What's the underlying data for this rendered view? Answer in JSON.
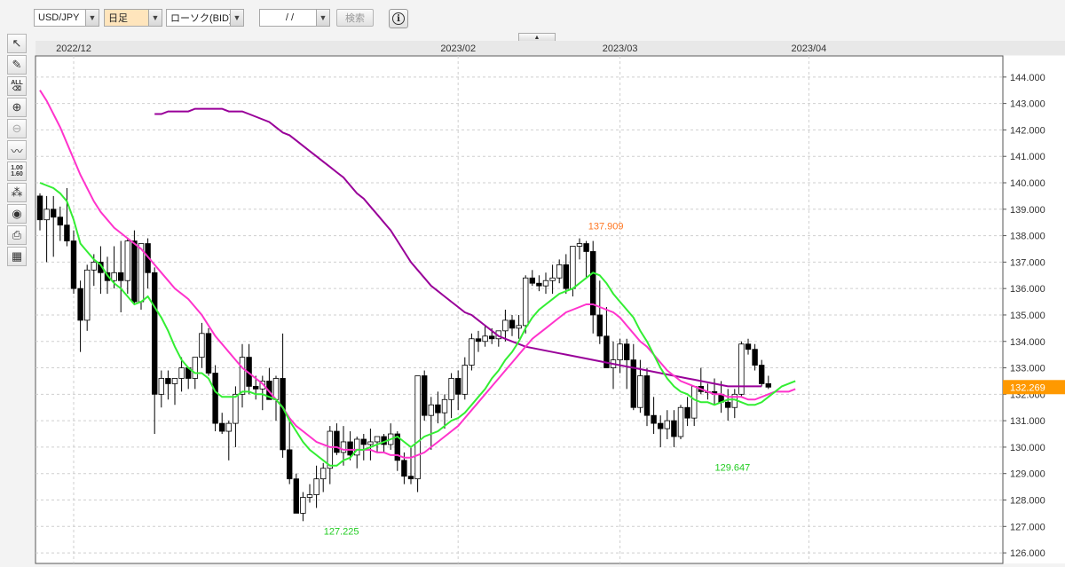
{
  "toolbar": {
    "symbol": "USD/JPY",
    "timeframe": "日足",
    "chart_style": "ローソク(BID)",
    "date_value": "/ /",
    "search_label": "検索"
  },
  "colors": {
    "up": "#ffffff",
    "down": "#000000",
    "ma_short": "#33ee33",
    "ma_mid": "#ff33cc",
    "ma_long": "#990099",
    "high_label": "#ff7722",
    "low_label": "#22cc22",
    "price_tag": "#ff9900"
  },
  "chart_data": {
    "type": "candlestick",
    "x_ticks": [
      {
        "index": 5,
        "label": "2022/12"
      },
      {
        "index": 62,
        "label": "2023/02"
      },
      {
        "index": 86,
        "label": "2023/03"
      },
      {
        "index": 114,
        "label": "2023/04"
      }
    ],
    "ylim": [
      125.6,
      144.8
    ],
    "y_ticks": [
      126,
      127,
      128,
      129,
      130,
      131,
      132,
      133,
      134,
      135,
      136,
      137,
      138,
      139,
      140,
      141,
      142,
      143,
      144
    ],
    "current_price": "132.269",
    "annotations": [
      {
        "index": 86,
        "value": 137.909,
        "label": "137.909",
        "kind": "high"
      },
      {
        "index": 46,
        "value": 127.225,
        "label": "127.225",
        "kind": "low"
      },
      {
        "index": 104,
        "value": 129.647,
        "label": "129.647",
        "kind": "low"
      }
    ],
    "candles": [
      [
        139.5,
        139.6,
        138.2,
        138.6
      ],
      [
        138.6,
        139.5,
        137.0,
        139.0
      ],
      [
        139.0,
        139.5,
        137.2,
        138.7
      ],
      [
        138.7,
        139.1,
        137.8,
        138.4
      ],
      [
        138.4,
        139.8,
        137.6,
        137.8
      ],
      [
        137.8,
        138.2,
        135.8,
        136.0
      ],
      [
        136.0,
        136.3,
        133.6,
        134.8
      ],
      [
        134.8,
        136.9,
        134.4,
        136.7
      ],
      [
        136.7,
        137.3,
        136.1,
        137.0
      ],
      [
        137.0,
        137.6,
        135.8,
        136.6
      ],
      [
        136.6,
        137.2,
        135.8,
        136.3
      ],
      [
        136.3,
        137.6,
        136.0,
        136.6
      ],
      [
        136.6,
        137.8,
        135.1,
        136.3
      ],
      [
        136.3,
        137.9,
        135.8,
        137.8
      ],
      [
        137.8,
        138.2,
        135.4,
        135.5
      ],
      [
        135.5,
        137.6,
        135.2,
        137.7
      ],
      [
        137.7,
        137.9,
        136.0,
        136.6
      ],
      [
        136.6,
        136.8,
        130.5,
        132.0
      ],
      [
        132.0,
        132.9,
        131.5,
        132.6
      ],
      [
        132.6,
        132.9,
        131.8,
        132.4
      ],
      [
        132.4,
        132.6,
        131.6,
        132.6
      ],
      [
        132.6,
        133.4,
        132.1,
        133.0
      ],
      [
        133.0,
        133.0,
        132.2,
        132.6
      ],
      [
        132.6,
        133.3,
        132.2,
        133.4
      ],
      [
        133.4,
        134.7,
        133.0,
        134.3
      ],
      [
        134.3,
        134.5,
        132.7,
        132.8
      ],
      [
        132.8,
        133.1,
        130.6,
        130.9
      ],
      [
        130.9,
        131.3,
        130.5,
        130.6
      ],
      [
        130.6,
        131.0,
        129.5,
        130.9
      ],
      [
        130.9,
        132.3,
        130.0,
        132.0
      ],
      [
        132.0,
        133.9,
        131.5,
        133.4
      ],
      [
        133.4,
        133.9,
        132.0,
        132.3
      ],
      [
        132.3,
        132.7,
        131.8,
        132.2
      ],
      [
        132.2,
        132.7,
        131.4,
        132.5
      ],
      [
        132.5,
        133.0,
        131.9,
        131.8
      ],
      [
        131.8,
        132.7,
        131.0,
        132.6
      ],
      [
        132.6,
        134.3,
        129.6,
        129.9
      ],
      [
        129.9,
        131.0,
        128.6,
        128.8
      ],
      [
        128.8,
        129.0,
        127.5,
        127.5
      ],
      [
        127.5,
        128.3,
        127.2,
        128.1
      ],
      [
        128.1,
        128.6,
        127.9,
        128.2
      ],
      [
        128.2,
        129.3,
        127.7,
        128.8
      ],
      [
        128.8,
        129.4,
        128.3,
        129.2
      ],
      [
        129.2,
        130.8,
        128.6,
        130.6
      ],
      [
        130.6,
        130.9,
        129.7,
        129.8
      ],
      [
        129.8,
        130.8,
        129.3,
        130.2
      ],
      [
        130.2,
        130.6,
        129.5,
        129.7
      ],
      [
        129.7,
        130.4,
        129.2,
        130.3
      ],
      [
        130.3,
        130.5,
        129.5,
        130.1
      ],
      [
        130.1,
        130.7,
        129.5,
        130.2
      ],
      [
        130.2,
        130.4,
        129.8,
        130.4
      ],
      [
        130.4,
        130.5,
        129.8,
        130.1
      ],
      [
        130.1,
        130.9,
        129.9,
        130.5
      ],
      [
        130.5,
        130.6,
        129.1,
        129.5
      ],
      [
        129.5,
        129.8,
        128.6,
        128.9
      ],
      [
        128.9,
        130.0,
        128.6,
        128.8
      ],
      [
        128.8,
        132.0,
        128.3,
        132.7
      ],
      [
        132.7,
        132.9,
        131.0,
        131.2
      ],
      [
        131.2,
        131.9,
        129.9,
        131.6
      ],
      [
        131.6,
        132.1,
        130.9,
        131.3
      ],
      [
        131.3,
        132.0,
        130.7,
        131.8
      ],
      [
        131.8,
        132.8,
        131.1,
        132.6
      ],
      [
        132.6,
        132.9,
        131.4,
        132.0
      ],
      [
        132.0,
        133.4,
        131.8,
        133.1
      ],
      [
        133.1,
        134.3,
        132.9,
        134.1
      ],
      [
        134.1,
        134.4,
        133.6,
        134.0
      ],
      [
        134.0,
        134.6,
        133.8,
        134.2
      ],
      [
        134.2,
        134.5,
        133.9,
        134.1
      ],
      [
        134.1,
        134.3,
        133.8,
        134.4
      ],
      [
        134.4,
        135.2,
        134.0,
        134.8
      ],
      [
        134.8,
        135.0,
        134.2,
        134.5
      ],
      [
        134.5,
        135.0,
        134.1,
        134.6
      ],
      [
        134.6,
        136.5,
        134.3,
        136.4
      ],
      [
        136.4,
        136.7,
        136.1,
        136.2
      ],
      [
        136.2,
        136.5,
        135.9,
        136.1
      ],
      [
        136.1,
        136.6,
        135.8,
        136.3
      ],
      [
        136.3,
        136.9,
        135.8,
        136.4
      ],
      [
        136.4,
        137.1,
        136.2,
        136.9
      ],
      [
        136.9,
        137.3,
        135.8,
        136.0
      ],
      [
        136.0,
        137.6,
        135.7,
        137.6
      ],
      [
        137.6,
        137.9,
        137.1,
        137.7
      ],
      [
        137.7,
        137.8,
        136.4,
        137.4
      ],
      [
        137.4,
        137.8,
        134.3,
        135.0
      ],
      [
        135.0,
        136.3,
        133.9,
        134.2
      ],
      [
        134.2,
        135.3,
        133.1,
        133.0
      ],
      [
        133.0,
        134.0,
        132.2,
        133.3
      ],
      [
        133.3,
        134.1,
        132.8,
        133.9
      ],
      [
        133.9,
        134.1,
        132.2,
        133.3
      ],
      [
        133.3,
        133.9,
        131.4,
        131.5
      ],
      [
        131.5,
        133.3,
        131.3,
        132.7
      ],
      [
        132.7,
        133.0,
        130.8,
        131.2
      ],
      [
        131.2,
        131.9,
        130.5,
        130.9
      ],
      [
        130.9,
        131.2,
        130.0,
        130.7
      ],
      [
        130.7,
        131.4,
        130.3,
        131.0
      ],
      [
        131.0,
        131.4,
        130.0,
        130.4
      ],
      [
        130.4,
        131.6,
        130.3,
        131.5
      ],
      [
        131.5,
        131.9,
        130.8,
        131.1
      ],
      [
        131.1,
        132.1,
        130.8,
        132.3
      ],
      [
        132.3,
        133.0,
        132.0,
        132.1
      ],
      [
        132.1,
        132.4,
        131.8,
        132.1
      ],
      [
        132.1,
        132.6,
        131.6,
        132.0
      ],
      [
        132.0,
        132.5,
        131.3,
        131.7
      ],
      [
        131.7,
        132.2,
        131.0,
        131.5
      ],
      [
        131.5,
        132.2,
        131.1,
        132.0
      ],
      [
        132.0,
        134.0,
        131.9,
        133.9
      ],
      [
        133.9,
        134.1,
        133.5,
        133.7
      ],
      [
        133.7,
        133.9,
        132.9,
        133.1
      ],
      [
        133.1,
        133.3,
        132.3,
        132.4
      ],
      [
        132.4,
        132.7,
        132.2,
        132.27
      ]
    ],
    "ma_short": [
      140.0,
      139.9,
      139.8,
      139.6,
      139.3,
      138.6,
      137.7,
      137.4,
      137.1,
      136.9,
      136.5,
      136.2,
      136.0,
      135.7,
      135.4,
      135.5,
      135.7,
      135.3,
      134.9,
      134.4,
      133.8,
      133.3,
      133.0,
      132.8,
      132.8,
      132.6,
      132.1,
      131.9,
      131.9,
      131.9,
      132.1,
      132.1,
      132.0,
      132.0,
      131.9,
      131.8,
      131.5,
      131.0,
      130.6,
      130.2,
      129.9,
      129.7,
      129.5,
      129.3,
      129.3,
      129.5,
      129.6,
      129.9,
      129.9,
      130.0,
      130.1,
      130.2,
      130.3,
      130.4,
      130.2,
      130.0,
      130.2,
      130.4,
      130.5,
      130.6,
      130.8,
      131.0,
      131.1,
      131.3,
      131.6,
      131.9,
      132.2,
      132.6,
      132.9,
      133.3,
      133.6,
      134.0,
      134.5,
      134.9,
      135.2,
      135.4,
      135.6,
      135.8,
      135.9,
      136.0,
      136.2,
      136.4,
      136.6,
      136.5,
      136.2,
      135.8,
      135.5,
      135.2,
      134.9,
      134.4,
      134.0,
      133.5,
      133.0,
      132.6,
      132.3,
      132.1,
      132.0,
      131.8,
      131.7,
      131.7,
      131.6,
      131.7,
      131.8,
      131.8,
      131.7,
      131.6,
      131.6,
      131.7,
      131.9,
      132.1,
      132.3,
      132.4,
      132.5
    ],
    "ma_mid": [
      143.5,
      143.1,
      142.6,
      142.1,
      141.5,
      140.9,
      140.3,
      139.8,
      139.3,
      138.9,
      138.6,
      138.3,
      138.1,
      137.9,
      137.7,
      137.5,
      137.2,
      136.9,
      136.6,
      136.3,
      136.0,
      135.8,
      135.6,
      135.3,
      135.0,
      134.6,
      134.2,
      133.9,
      133.6,
      133.3,
      133.0,
      132.8,
      132.6,
      132.4,
      132.1,
      131.8,
      131.5,
      131.1,
      130.8,
      130.6,
      130.4,
      130.2,
      130.1,
      130.0,
      130.0,
      129.9,
      129.9,
      129.9,
      129.9,
      129.9,
      129.8,
      129.8,
      129.7,
      129.7,
      129.6,
      129.6,
      129.7,
      129.8,
      130.0,
      130.2,
      130.4,
      130.6,
      130.8,
      131.1,
      131.4,
      131.7,
      132.0,
      132.3,
      132.6,
      132.9,
      133.2,
      133.5,
      133.8,
      134.1,
      134.3,
      134.5,
      134.7,
      134.9,
      135.1,
      135.2,
      135.3,
      135.4,
      135.4,
      135.3,
      135.2,
      135.1,
      134.9,
      134.6,
      134.3,
      134.0,
      133.8,
      133.5,
      133.2,
      132.9,
      132.7,
      132.5,
      132.4,
      132.3,
      132.2,
      132.1,
      132.0,
      132.0,
      131.9,
      131.9,
      131.9,
      131.8,
      131.8,
      131.9,
      132.0,
      132.1,
      132.1,
      132.1,
      132.2
    ],
    "ma_long": [
      142.6,
      142.6,
      142.7,
      142.7,
      142.7,
      142.7,
      142.8,
      142.8,
      142.8,
      142.8,
      142.8,
      142.7,
      142.7,
      142.7,
      142.6,
      142.5,
      142.4,
      142.3,
      142.1,
      141.9,
      141.8,
      141.6,
      141.4,
      141.2,
      141.0,
      140.8,
      140.6,
      140.4,
      140.2,
      139.9,
      139.6,
      139.4,
      139.1,
      138.8,
      138.5,
      138.2,
      137.8,
      137.4,
      137.0,
      136.7,
      136.4,
      136.1,
      135.9,
      135.7,
      135.5,
      135.3,
      135.1,
      135.0,
      134.8,
      134.6,
      134.4,
      134.2,
      134.1,
      134.0,
      133.9,
      133.8,
      133.75,
      133.7,
      133.65,
      133.6,
      133.55,
      133.5,
      133.45,
      133.4,
      133.35,
      133.3,
      133.25,
      133.2,
      133.15,
      133.1,
      133.05,
      133.0,
      132.95,
      132.9,
      132.85,
      132.8,
      132.75,
      132.7,
      132.65,
      132.6,
      132.55,
      132.5,
      132.45,
      132.4,
      132.35,
      132.3,
      132.3,
      132.3,
      132.3,
      132.3,
      132.3
    ]
  }
}
